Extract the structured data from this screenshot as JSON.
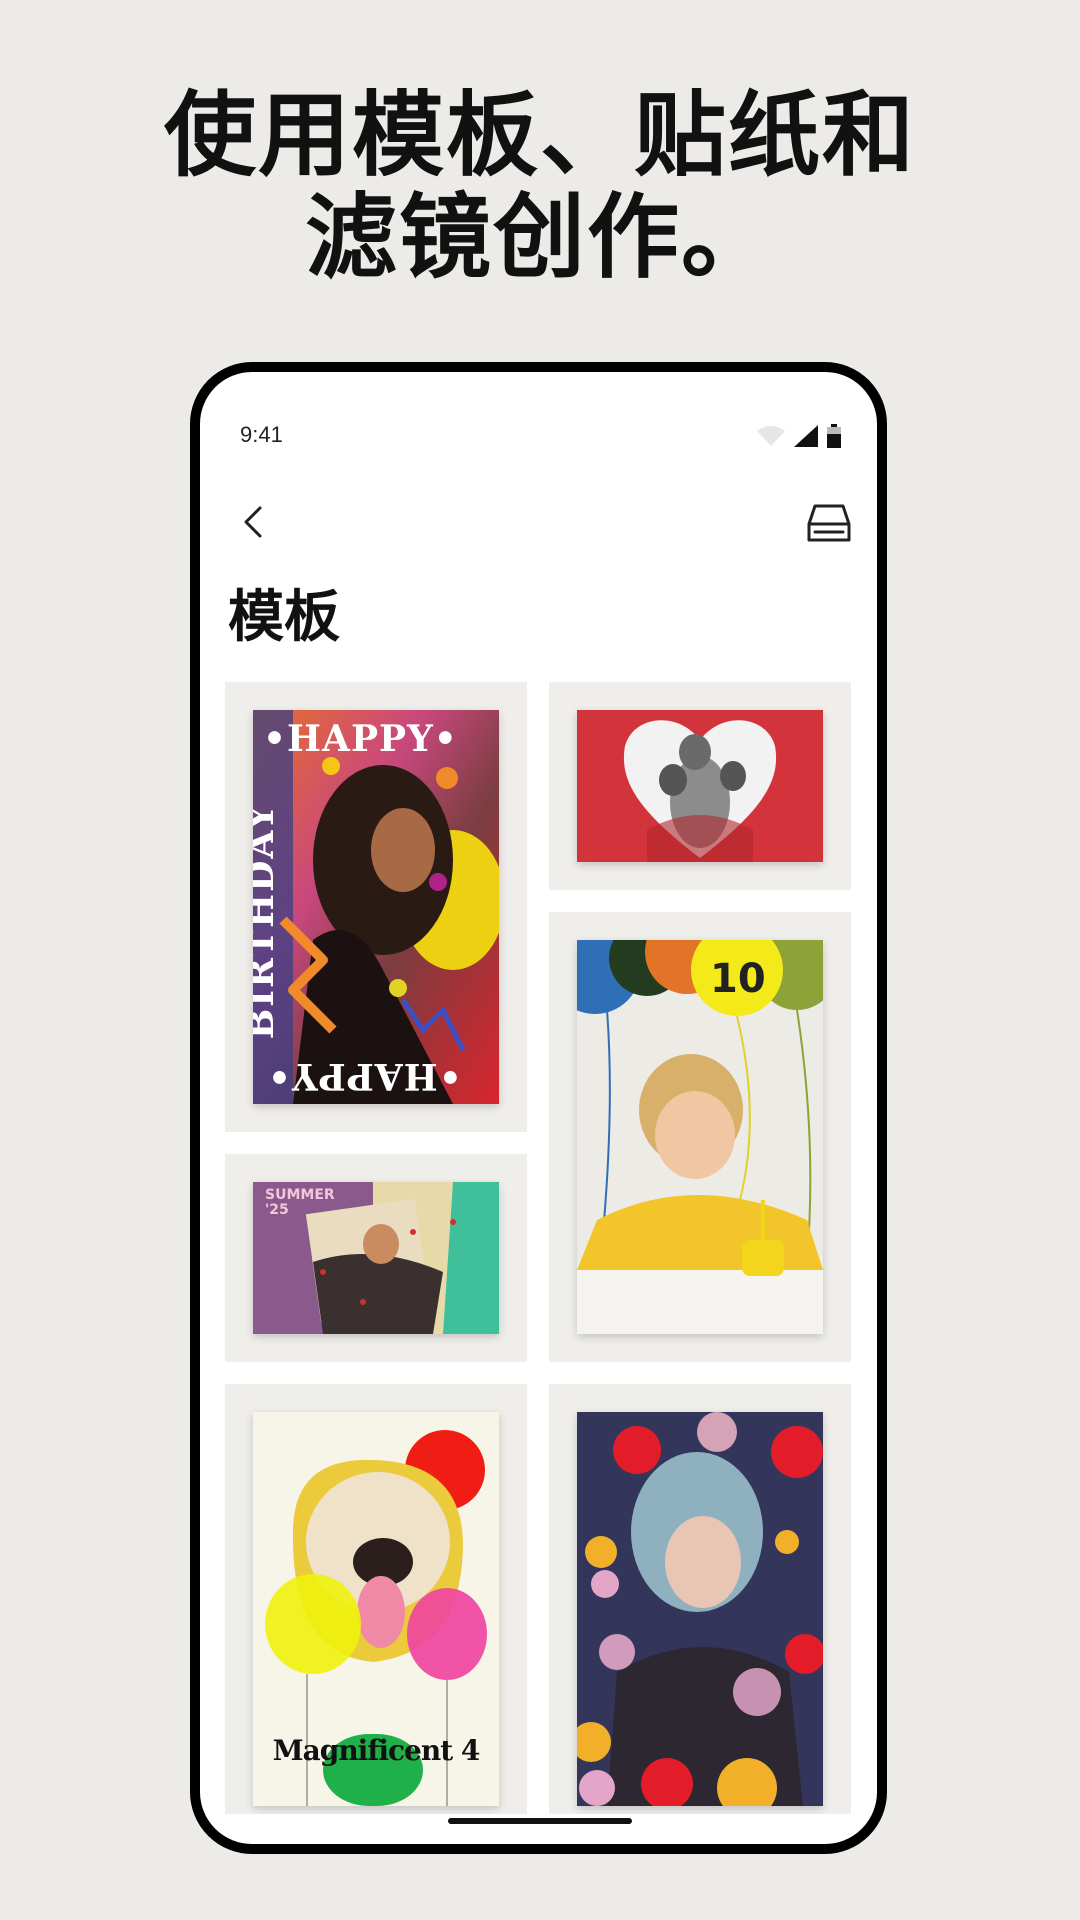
{
  "headline": {
    "line1": "使用模板、贴纸和",
    "line2": "滤镜创作。"
  },
  "status_bar": {
    "time": "9:41",
    "icons": [
      "wifi-icon",
      "cellular-signal-icon",
      "battery-icon"
    ]
  },
  "nav": {
    "back_icon": "chevron-left-icon",
    "right_icon": "storage-drive-icon"
  },
  "page_title": "模板",
  "templates": [
    {
      "name": "happy-birthday",
      "texts": {
        "top": "•HAPPY•",
        "side": "BIRTHDAY",
        "bottom": "•HAPPY•"
      }
    },
    {
      "name": "heart-family"
    },
    {
      "name": "balloon-birthday",
      "texts": {
        "number": "10"
      }
    },
    {
      "name": "summer",
      "texts": {
        "label": "SUMMER\n'25"
      }
    },
    {
      "name": "magnificent-dog",
      "texts": {
        "caption": "Magnificent 4"
      }
    },
    {
      "name": "bokeh-portrait"
    }
  ],
  "colors": {
    "background": "#ecebe8",
    "card_bg": "#efeeeb",
    "phone_frame": "#000000",
    "heart_red": "#d3333a",
    "balloon_yellow": "#f5ea19"
  }
}
